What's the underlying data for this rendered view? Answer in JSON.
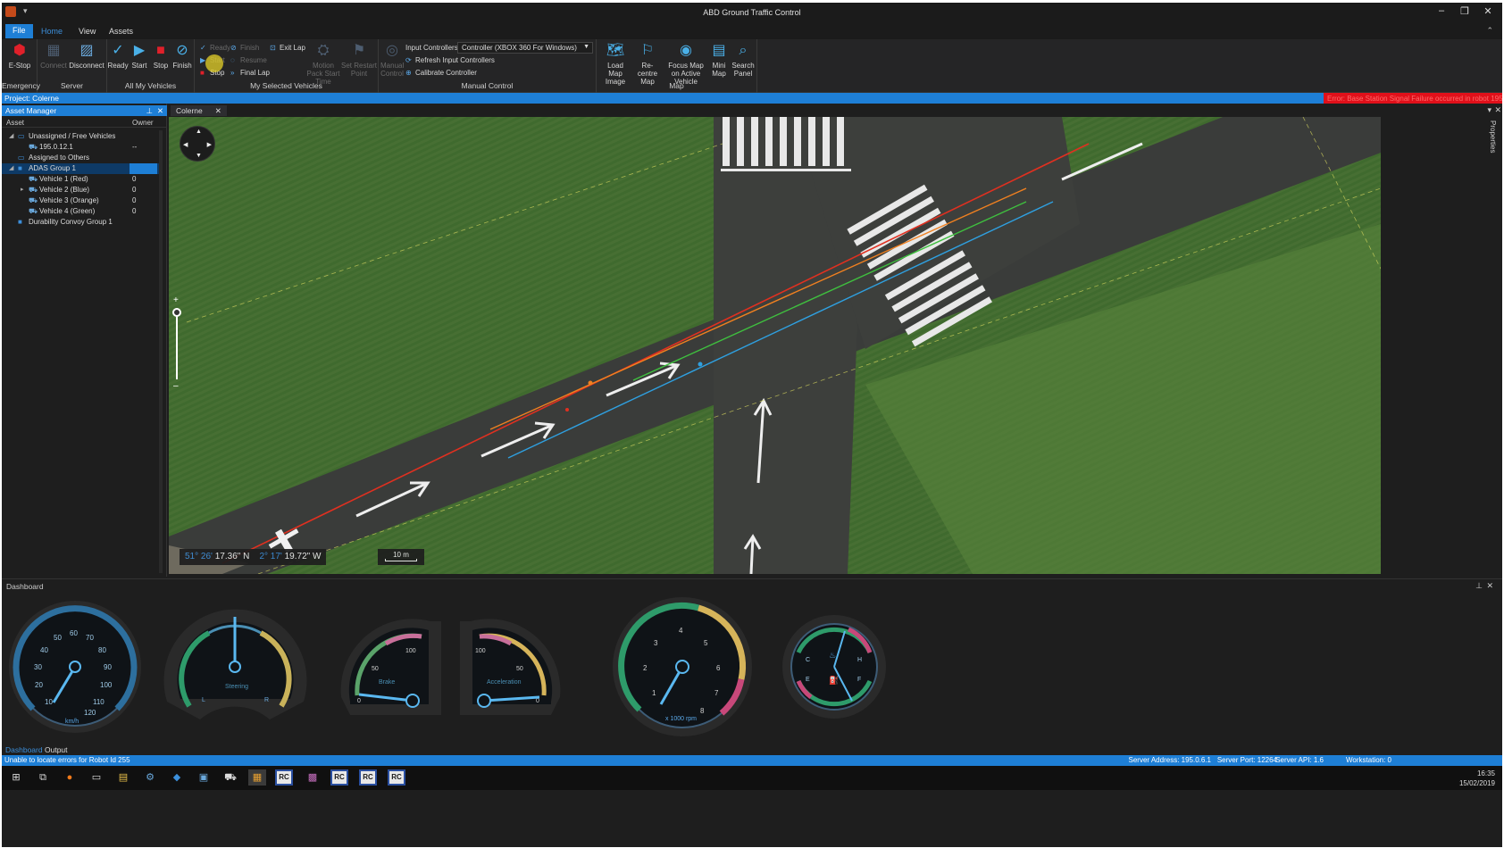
{
  "window": {
    "title": "ABD Ground Traffic Control",
    "qa": "▾",
    "min": "–",
    "restore": "❐",
    "close": "✕"
  },
  "tabs": {
    "file": "File",
    "home": "Home",
    "view": "View",
    "assets": "Assets",
    "caret": "⌃"
  },
  "ribbon": {
    "emergency": {
      "label": "Emergency",
      "estop": "E-Stop"
    },
    "server": {
      "label": "Server",
      "connect": "Connect",
      "disconnect": "Disconnect"
    },
    "all_vehicles": {
      "label": "All My Vehicles",
      "ready": "Ready",
      "start": "Start",
      "stop": "Stop",
      "finish": "Finish"
    },
    "selected": {
      "label": "My Selected Vehicles",
      "ready": "Ready",
      "finish": "Finish",
      "exit_lap": "Exit Lap",
      "start": "Start",
      "resume": "Resume",
      "stop": "Stop",
      "final_lap": "Final Lap",
      "motion_pack": "Motion Pack Start Time",
      "set_restart": "Set Restart Point"
    },
    "manual": {
      "label": "Manual Control",
      "manual_control": "Manual Control",
      "input_controllers": "Input Controllers",
      "controller_value": "Controller (XBOX 360 For Windows)",
      "refresh": "Refresh Input Controllers",
      "calibrate": "Calibrate Controller"
    },
    "map": {
      "label": "Map",
      "load_map": "Load Map Image",
      "recentre": "Re-centre Map",
      "focus": "Focus Map on Active Vehicle",
      "mini": "Mini Map",
      "search": "Search Panel"
    }
  },
  "project": {
    "label": "Project: Colerne",
    "error": "Error: Base Station Signal Failure occurred in robot 195.0.12.1"
  },
  "asset_manager": {
    "title": "Asset Manager",
    "col_asset": "Asset",
    "col_owner": "Owner",
    "rows": [
      {
        "label": "Unassigned / Free Vehicles",
        "owner": ""
      },
      {
        "label": "195.0.12.1",
        "owner": "--"
      },
      {
        "label": "Assigned to Others",
        "owner": ""
      },
      {
        "label": "ADAS Group 1",
        "owner": ""
      },
      {
        "label": "Vehicle 1 (Red)",
        "owner": "0"
      },
      {
        "label": "Vehicle 2 (Blue)",
        "owner": "0"
      },
      {
        "label": "Vehicle 3 (Orange)",
        "owner": "0"
      },
      {
        "label": "Vehicle 4 (Green)",
        "owner": "0"
      },
      {
        "label": "Durability Convoy Group 1",
        "owner": ""
      }
    ]
  },
  "map": {
    "tab": "Colerne",
    "lat_deg": "51°",
    "lat_min": "26'",
    "lat_sec": "17.36\" N",
    "lon_deg": "2°",
    "lon_min": "17'",
    "lon_sec": "19.72\" W",
    "scale": "10 m",
    "zoom_plus": "+",
    "zoom_minus": "–",
    "properties": "Properties"
  },
  "dashboard": {
    "title": "Dashboard",
    "speed": {
      "unit": "km/h",
      "ticks": [
        "10",
        "20",
        "30",
        "40",
        "50",
        "60",
        "70",
        "80",
        "90",
        "100",
        "110",
        "120"
      ]
    },
    "steering": {
      "label": "Steering",
      "l": "L",
      "r": "R"
    },
    "brake": {
      "label": "Brake",
      "min": "0",
      "mid": "50",
      "max": "100"
    },
    "accel": {
      "label": "Acceleration",
      "min": "0",
      "mid": "50",
      "max": "100"
    },
    "rpm": {
      "unit": "x 1000 rpm",
      "ticks": [
        "1",
        "2",
        "3",
        "4",
        "5",
        "6",
        "7",
        "8"
      ]
    },
    "temp_fuel": {
      "c": "C",
      "h": "H",
      "e": "E",
      "f": "F"
    }
  },
  "bottom_tabs": {
    "dashboard": "Dashboard",
    "output": "Output"
  },
  "status": {
    "message": "Unable to locate errors for Robot Id 255",
    "server_address": "Server Address: 195.0.6.1",
    "server_port": "Server Port: 12264",
    "server_api": "Server API: 1.6",
    "workstation": "Workstation: 0"
  },
  "clock": {
    "time": "16:35",
    "date": "15/02/2019"
  },
  "taskbar": {
    "rc": "RC"
  },
  "colors": {
    "accent": "#1e7fd6",
    "error": "#e0101a",
    "red_path": "#e03020",
    "green_path": "#3fbf3f",
    "blue_path": "#2fa0e0",
    "orange_path": "#f08020"
  }
}
